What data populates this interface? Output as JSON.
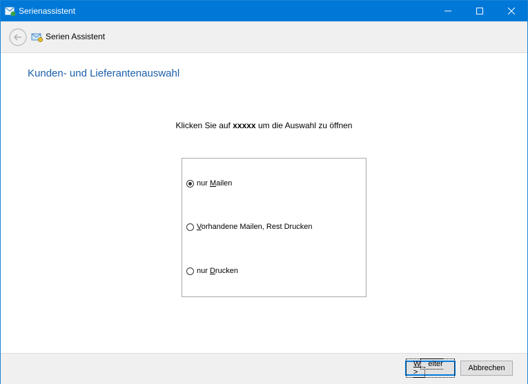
{
  "window": {
    "title": "Serienassistent",
    "minimize_glyph": "—",
    "maximize_glyph": "☐",
    "close_glyph": "✕"
  },
  "navbar": {
    "title": "Serien Assistent",
    "back_icon": "back-arrow-icon",
    "wizard_icon": "mail-wizard-icon"
  },
  "page": {
    "heading": "Kunden- und Lieferantenauswahl",
    "instruction_prefix": "Klicken Sie auf ",
    "instruction_bold": "xxxxx",
    "instruction_suffix": " um die Auswahl zu öffnen"
  },
  "options": [
    {
      "label_pre": "nur ",
      "label_accel": "M",
      "label_post": "ailen",
      "checked": true
    },
    {
      "label_pre": "",
      "label_accel": "V",
      "label_post": "orhandene Mailen, Rest Drucken",
      "checked": false
    },
    {
      "label_pre": "nur ",
      "label_accel": "D",
      "label_post": "rucken",
      "checked": false
    }
  ],
  "footer": {
    "next_accel": "W",
    "next_rest": "eiter >",
    "cancel_label": "Abbrechen"
  },
  "colors": {
    "titlebar": "#0078d7",
    "heading": "#1a5fa8"
  }
}
